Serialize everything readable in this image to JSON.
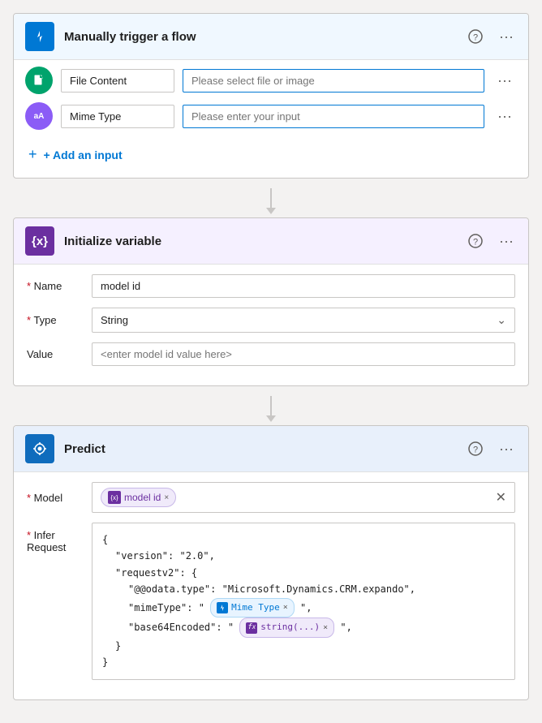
{
  "trigger": {
    "title": "Manually trigger a flow",
    "header_bg": "#e8f4ff",
    "icon_bg": "#0078d4",
    "help_icon": "?",
    "more_icon": "···",
    "inputs": [
      {
        "id": "file-content",
        "label": "File Content",
        "placeholder": "Please select file or image",
        "icon_label": "",
        "icon_bg": "#00a36c",
        "icon_type": "file"
      },
      {
        "id": "mime-type",
        "label": "Mime Type",
        "placeholder": "Please enter your input",
        "icon_label": "aA",
        "icon_bg": "#8b5cf6",
        "icon_type": "text"
      }
    ],
    "add_input_label": "+ Add an input"
  },
  "init_variable": {
    "title": "Initialize variable",
    "icon_symbol": "{x}",
    "name_label": "* Name",
    "name_value": "model id",
    "type_label": "* Type",
    "type_value": "String",
    "value_label": "Value",
    "value_placeholder": "<enter model id value here>"
  },
  "predict": {
    "title": "Predict",
    "model_label": "* Model",
    "model_tag_label": "model id",
    "model_tag_x": "×",
    "infer_label": "* Infer Request",
    "json_lines": [
      "{",
      "  \"version\": \"2.0\",",
      "  \"requestv2\": {",
      "  \"@@odata.type\": \"Microsoft.Dynamics.CRM.expando\",",
      "  \"mimeType\": \"",
      "  \"base64Encoded\": \"",
      "  }",
      "}"
    ],
    "mime_type_tag": "Mime Type",
    "string_tag": "string(...)",
    "suffix_mime": " \",",
    "suffix_string": " \","
  }
}
